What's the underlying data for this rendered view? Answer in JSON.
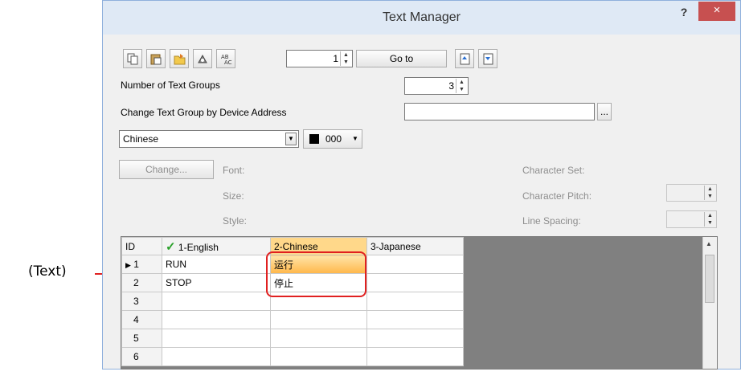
{
  "window": {
    "title": "Text Manager",
    "help": "?",
    "close": "×"
  },
  "toolbar": {
    "row_number": "1",
    "goto_label": "Go to"
  },
  "text_groups": {
    "label": "Number of Text Groups",
    "value": "3"
  },
  "device_address": {
    "label": "Change Text Group by Device Address",
    "browse": "..."
  },
  "language_select": {
    "value": "Chinese"
  },
  "color_select": {
    "value": "000"
  },
  "font_section": {
    "change_button": "Change...",
    "font_label": "Font:",
    "size_label": "Size:",
    "style_label": "Style:",
    "charset_label": "Character Set:",
    "pitch_label": "Character Pitch:",
    "spacing_label": "Line Spacing:"
  },
  "grid": {
    "headers": [
      "ID",
      "1-English",
      "2-Chinese",
      "3-Japanese"
    ],
    "rows": [
      {
        "id": "1",
        "en": "RUN",
        "zh": "运行",
        "ja": ""
      },
      {
        "id": "2",
        "en": "STOP",
        "zh": "停止",
        "ja": ""
      },
      {
        "id": "3",
        "en": "",
        "zh": "",
        "ja": ""
      },
      {
        "id": "4",
        "en": "",
        "zh": "",
        "ja": ""
      },
      {
        "id": "5",
        "en": "",
        "zh": "",
        "ja": ""
      },
      {
        "id": "6",
        "en": "",
        "zh": "",
        "ja": ""
      }
    ]
  },
  "callout": {
    "label": "(Text)"
  },
  "colors": {
    "accent_red": "#e02020",
    "close_red": "#c75050",
    "selected_header": "#ffd88a"
  }
}
